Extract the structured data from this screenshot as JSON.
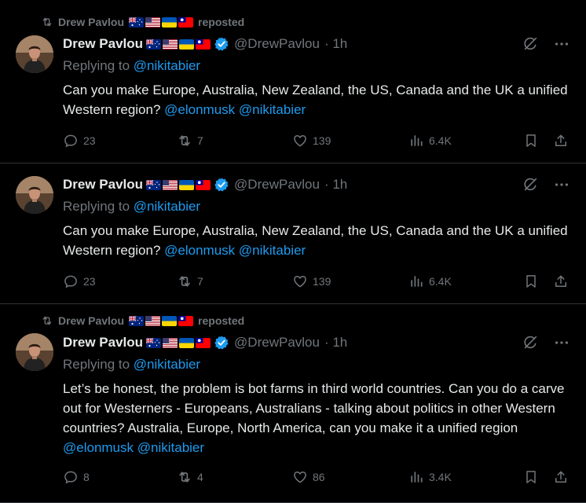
{
  "colors": {
    "background": "#000000",
    "text": "#e7e9ea",
    "muted": "#71767b",
    "accent": "#1d9bf0",
    "separator": "#2f3336"
  },
  "tweets": [
    {
      "repost_label": "reposted",
      "repost_user": "Drew Pavlou",
      "name": "Drew Pavlou",
      "handle": "@DrewPavlou",
      "time": "· 1h",
      "replying_prefix": "Replying to",
      "replying_to": "@nikitabier",
      "text": "Can you make Europe, Australia, New Zealand, the US, Canada and the UK a unified Western region?",
      "mentions": [
        "@elonmusk",
        "@nikitabier"
      ],
      "replies": "23",
      "reposts": "7",
      "likes": "139",
      "views": "6.4K"
    },
    {
      "name": "Drew Pavlou",
      "handle": "@DrewPavlou",
      "time": "· 1h",
      "replying_prefix": "Replying to",
      "replying_to": "@nikitabier",
      "text": "Can you make Europe, Australia, New Zealand, the US, Canada and the UK a unified Western region?",
      "mentions": [
        "@elonmusk",
        "@nikitabier"
      ],
      "replies": "23",
      "reposts": "7",
      "likes": "139",
      "views": "6.4K"
    },
    {
      "repost_label": "reposted",
      "repost_user": "Drew Pavlou",
      "name": "Drew Pavlou",
      "handle": "@DrewPavlou",
      "time": "· 1h",
      "replying_prefix": "Replying to",
      "replying_to": "@nikitabier",
      "text": "Let’s be honest, the problem is bot farms in third world countries. Can you do a carve out for Westerners - Europeans, Australians - talking about politics in other Western countries? Australia, Europe, North America, can you make it a unified region",
      "mentions": [
        "@elonmusk",
        "@nikitabier"
      ],
      "replies": "8",
      "reposts": "4",
      "likes": "86",
      "views": "3.4K"
    }
  ]
}
